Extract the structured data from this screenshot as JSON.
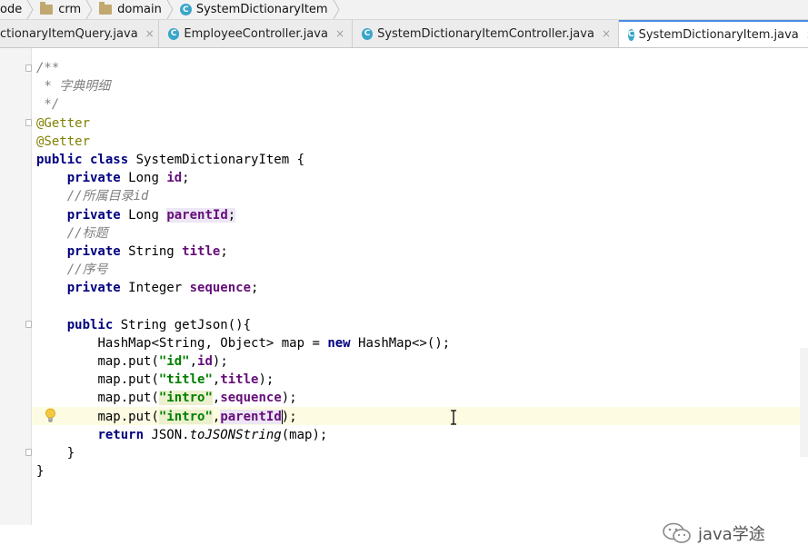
{
  "breadcrumb": {
    "items": [
      {
        "label": "ode",
        "icon": "none"
      },
      {
        "label": "crm",
        "icon": "folder-icon"
      },
      {
        "label": "domain",
        "icon": "folder-icon"
      },
      {
        "label": "SystemDictionaryItem",
        "icon": "class-icon"
      }
    ]
  },
  "tabs": [
    {
      "label": "ctionaryItemQuery.java",
      "active": false
    },
    {
      "label": "EmployeeController.java",
      "active": false
    },
    {
      "label": "SystemDictionaryItemController.java",
      "active": false
    },
    {
      "label": "SystemDictionaryItem.java",
      "active": true
    }
  ],
  "class_badge": "C",
  "close_glyph": "×",
  "code": {
    "l1": "/**",
    "l2": " * 字典明细",
    "l3": " */",
    "l4": "@Getter",
    "l5": "@Setter",
    "l6_kw": "public class",
    "l6_rest": " SystemDictionaryItem {",
    "l7_kw": "private",
    "l7_type": " Long ",
    "l7_field": "id",
    "l8": "//所属目录",
    "l8_id": "id",
    "l9_kw": "private",
    "l9_type": " Long ",
    "l9_field": "parentId",
    "l10": "//标题",
    "l11_kw": "private",
    "l11_type": " String ",
    "l11_field": "title",
    "l12": "//序号",
    "l13_kw": "private",
    "l13_type": " Integer ",
    "l13_field": "sequence",
    "l15_kw": "public",
    "l15_rest": " String getJson(){",
    "l16_a": "HashMap<String, Object> map = ",
    "l16_kw": "new",
    "l16_b": " HashMap<>();",
    "put": "map.put(",
    "s_id": "\"id\"",
    "s_title": "\"title\"",
    "s_intro": "\"intro\"",
    "f_id": "id",
    "f_title": "title",
    "f_sequence": "sequence",
    "f_parentId": "parentId",
    "close_paren": ");",
    "comma": ",",
    "l21_kw": "return",
    "l21_a": " JSON.",
    "l21_m": "toJSONString",
    "l21_b": "(map);",
    "l22": "}",
    "l23": "}"
  },
  "watermark": "java学途"
}
